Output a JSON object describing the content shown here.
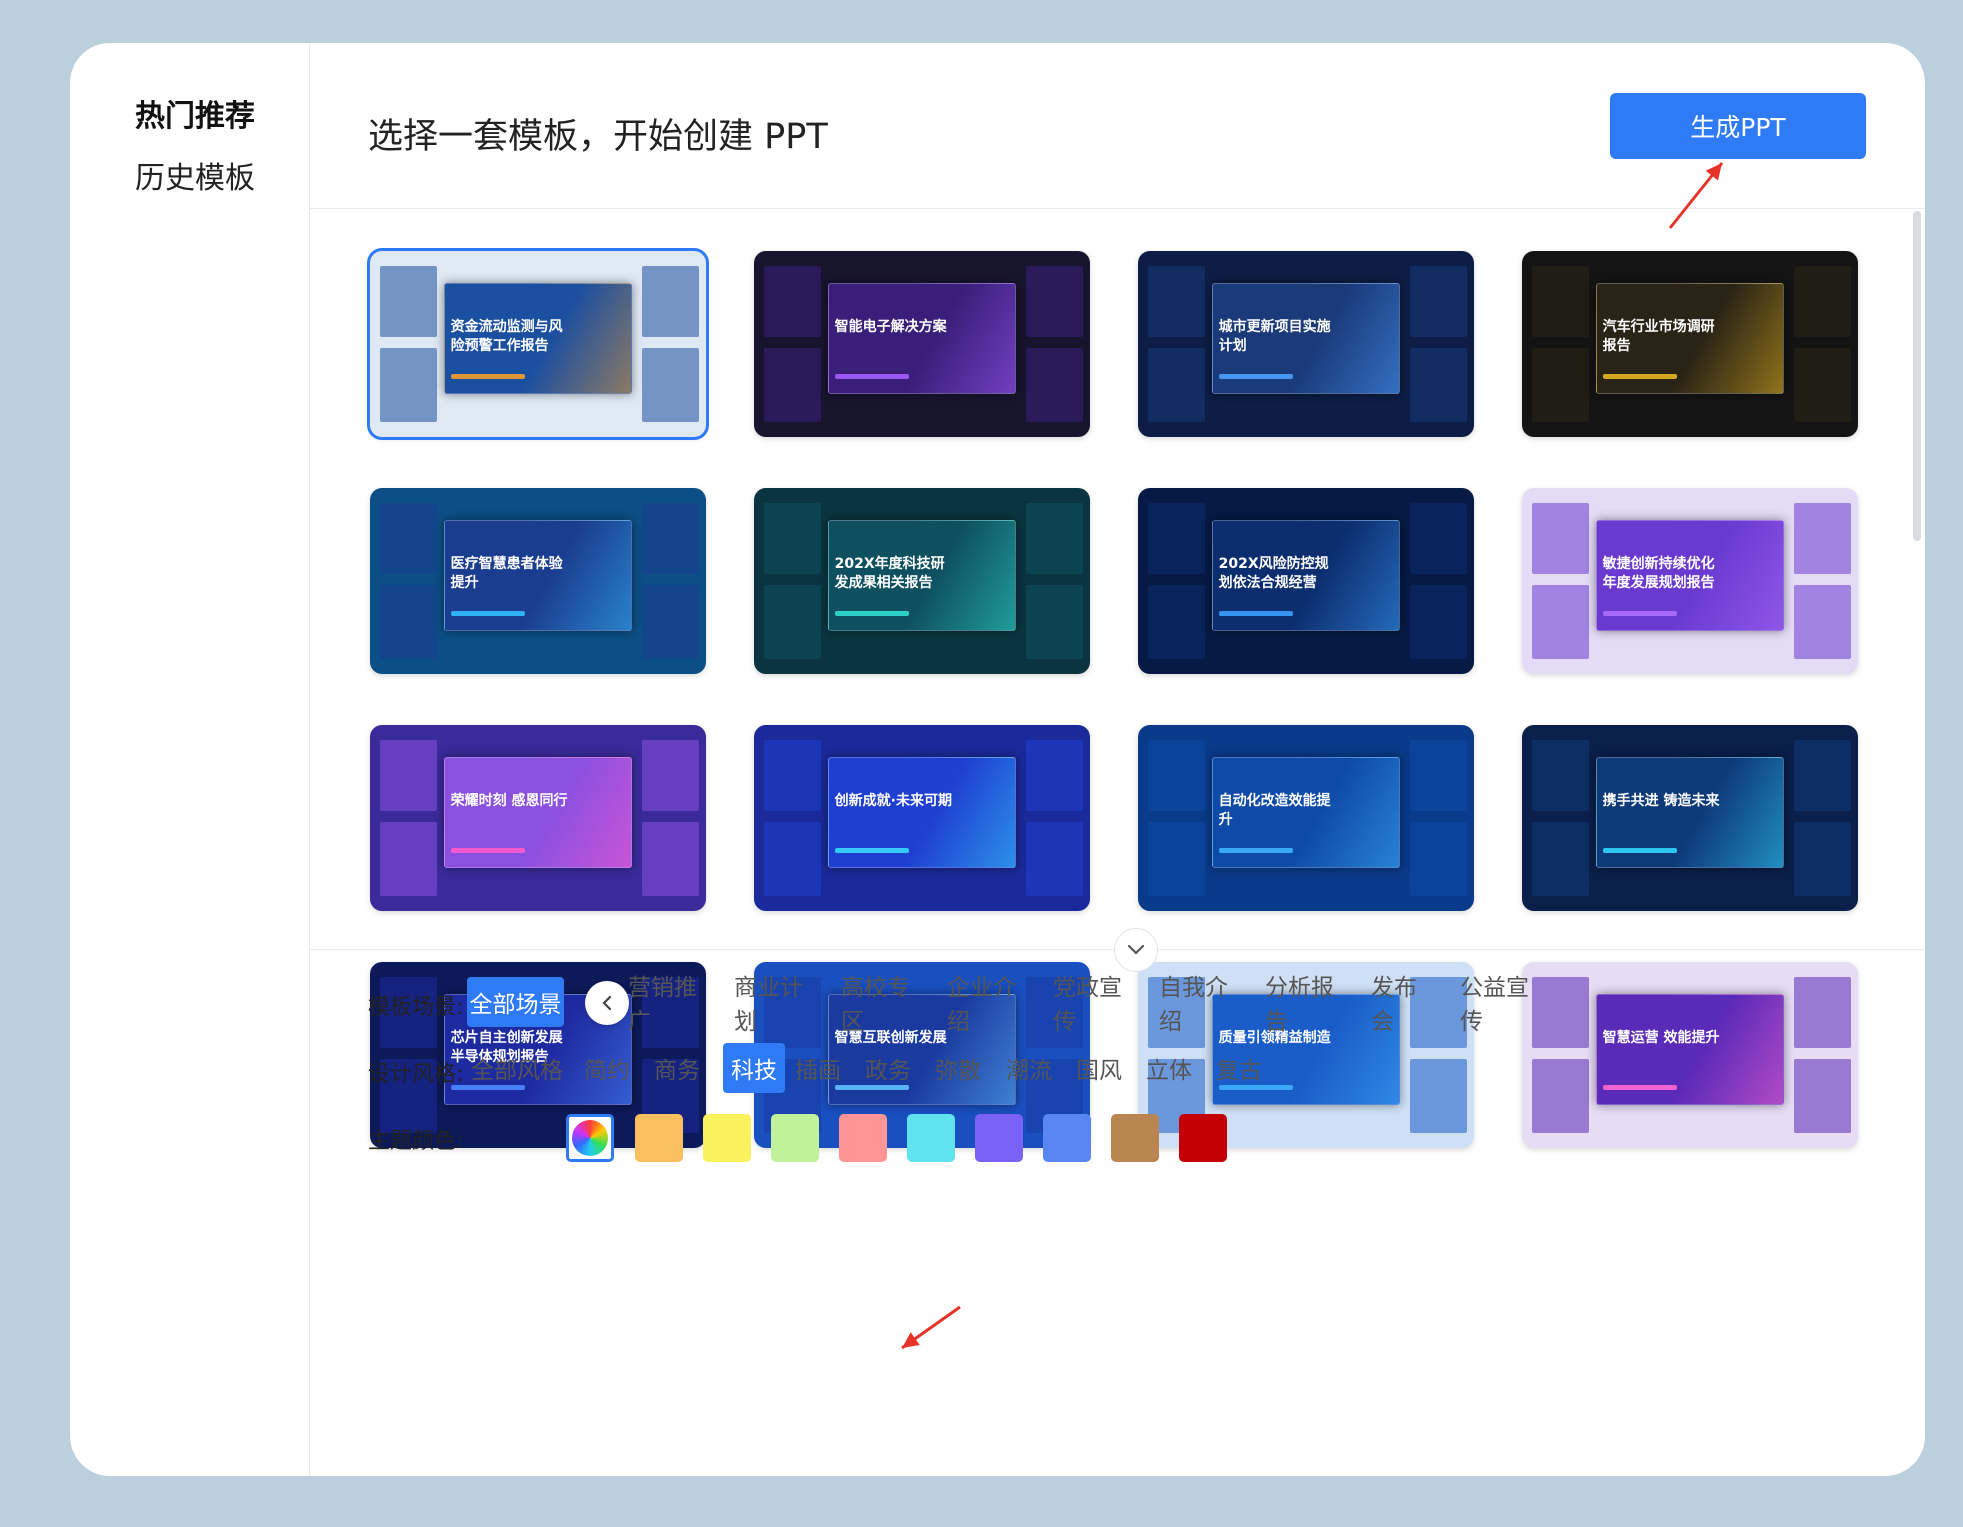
{
  "sidebar": {
    "items": [
      {
        "label": "热门推荐",
        "active": true
      },
      {
        "label": "历史模板",
        "active": false
      }
    ]
  },
  "header": {
    "title": "选择一套模板，开始创建 PPT",
    "generate_button": "生成PPT"
  },
  "templates": [
    {
      "title": "资金流动监测与风险预警工作报告",
      "bg": "#dfe9f4",
      "inner": "#1b4fa0",
      "accent": "#f0a030",
      "selected": true
    },
    {
      "title": "智能电子解决方案",
      "bg": "#17142e",
      "inner": "#3a1f7a",
      "accent": "#a35cff",
      "selected": false
    },
    {
      "title": "城市更新项目实施计划",
      "bg": "#0d1d45",
      "inner": "#1a3a7a",
      "accent": "#4aa0ff",
      "selected": false
    },
    {
      "title": "汽车行业市场调研报告",
      "bg": "#141414",
      "inner": "#2a2416",
      "accent": "#e8b820",
      "selected": false
    },
    {
      "title": "医疗智慧患者体验提升",
      "bg": "#0c4f86",
      "inner": "#1b3d8f",
      "accent": "#33c0ff",
      "selected": false
    },
    {
      "title": "202X年度科技研发成果相关报告",
      "bg": "#0a3540",
      "inner": "#0f5060",
      "accent": "#2fe0d0",
      "selected": false
    },
    {
      "title": "202X风险防控规划依法合规经营",
      "bg": "#061a45",
      "inner": "#0c2d6e",
      "accent": "#3aa0ff",
      "selected": false
    },
    {
      "title": "敏捷创新持续优化年度发展规划报告",
      "bg": "#e4dcf6",
      "inner": "#6a3ad0",
      "accent": "#b070ff",
      "selected": false
    },
    {
      "title": "荣耀时刻 感恩同行",
      "bg": "#3a2a9a",
      "inner": "#8a50e0",
      "accent": "#ff5acd",
      "selected": false
    },
    {
      "title": "创新成就·未来可期",
      "bg": "#1a2a9a",
      "inner": "#1f3fd0",
      "accent": "#38d8ff",
      "selected": false
    },
    {
      "title": "自动化改造效能提升",
      "bg": "#0a3a8a",
      "inner": "#0e4aa8",
      "accent": "#40b4ff",
      "selected": false
    },
    {
      "title": "携手共进 铸造未来",
      "bg": "#0a1f4a",
      "inner": "#0e3a7a",
      "accent": "#30d8ff",
      "selected": false
    },
    {
      "title": "芯片自主创新发展半导体规划报告",
      "bg": "#0c1a5a",
      "inner": "#1e2aa0",
      "accent": "#4a8aff",
      "selected": false
    },
    {
      "title": "智慧互联创新发展",
      "bg": "#1a4fc0",
      "inner": "#1a3aa0",
      "accent": "#60c0ff",
      "selected": false
    },
    {
      "title": "质量引领精益制造",
      "bg": "#cfe0f6",
      "inner": "#1a5cc8",
      "accent": "#40b0ff",
      "selected": false
    },
    {
      "title": "智慧运营 效能提升",
      "bg": "#e6dcf4",
      "inner": "#5a2ab8",
      "accent": "#ff6ad0",
      "selected": false
    }
  ],
  "filters": {
    "scene_label": "模板场景:",
    "scene_options": [
      "全部场景",
      "营销推广",
      "商业计划",
      "高校专区",
      "企业介绍",
      "党政宣传",
      "自我介绍",
      "分析报告",
      "发布会",
      "公益宣传"
    ],
    "scene_selected": "全部场景",
    "style_label": "设计风格:",
    "style_options": [
      "全部风格",
      "简约",
      "商务",
      "科技",
      "插画",
      "政务",
      "弥散",
      "潮流",
      "国风",
      "立体",
      "复古"
    ],
    "style_selected": "科技",
    "color_label": "主题颜色:",
    "colors": [
      "#fcbf5f",
      "#f9f25e",
      "#bff29a",
      "#ff9595",
      "#61e3ef",
      "#7a62f6",
      "#5a86f4",
      "#b98652",
      "#c40004"
    ]
  },
  "annotation_color": "#e8332a",
  "icons": {
    "expand": "chevron-down-icon",
    "prev": "chevron-left-icon",
    "all_colors": "color-wheel-icon"
  }
}
